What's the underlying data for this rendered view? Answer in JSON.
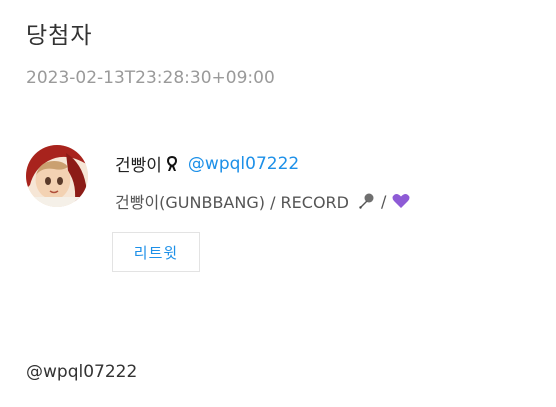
{
  "page": {
    "title": "당첨자",
    "timestamp": "2023-02-13T23:28:30+09:00"
  },
  "winner": {
    "display_name": "건빵이",
    "handle": "@wpql07222",
    "bio_text": "건빵이(GUNBBANG) / RECORD",
    "bio_separator": "/",
    "icons": [
      "ribbon-icon",
      "microphone-icon",
      "purple-heart-icon"
    ],
    "heart_color": "#8e5bd6",
    "retweet_label": "리트윗"
  },
  "footer": {
    "mention": "@wpql07222"
  },
  "colors": {
    "link": "#1d90e8",
    "timestamp": "#9a9a9a"
  }
}
